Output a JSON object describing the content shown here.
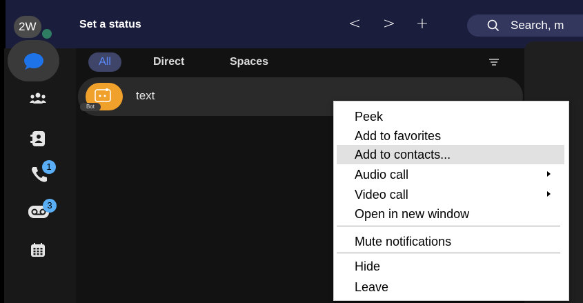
{
  "window": {
    "avatar_initials": "2W",
    "status_label": "Set a status",
    "back_symbol": "<",
    "forward_symbol": ">",
    "new_symbol": "+",
    "search_placeholder": "Search, m"
  },
  "rail": {
    "items": [
      {
        "name": "messaging-icon",
        "active": true
      },
      {
        "name": "teams-icon"
      },
      {
        "name": "contacts-icon"
      },
      {
        "name": "calling-icon",
        "badge": "1"
      },
      {
        "name": "voicemail-icon",
        "badge": "3"
      },
      {
        "name": "calendar-icon"
      }
    ]
  },
  "list": {
    "filters": [
      "All",
      "Direct",
      "Spaces"
    ],
    "filter_icon": "filter-lines-icon",
    "rows": [
      {
        "name": "text",
        "tag": "Bot"
      }
    ]
  },
  "context_menu": {
    "items": [
      {
        "label": "Peek"
      },
      {
        "label": "Add to favorites"
      },
      {
        "label": "Add to contacts..."
      },
      {
        "label": "Audio call",
        "submenu": true
      },
      {
        "label": "Video call",
        "submenu": true
      },
      {
        "label": "Open in new window"
      },
      {
        "label": "Mute notifications"
      },
      {
        "label": "Hide"
      },
      {
        "label": "Leave"
      }
    ],
    "highlighted": "Add to contacts..."
  },
  "colors": {
    "topbar": "#1a1d3b",
    "accent_blue": "#5b8cff",
    "badge_blue": "#5aaef5",
    "bot_orange": "#f0a12c",
    "presence_green": "#2e7d63"
  }
}
